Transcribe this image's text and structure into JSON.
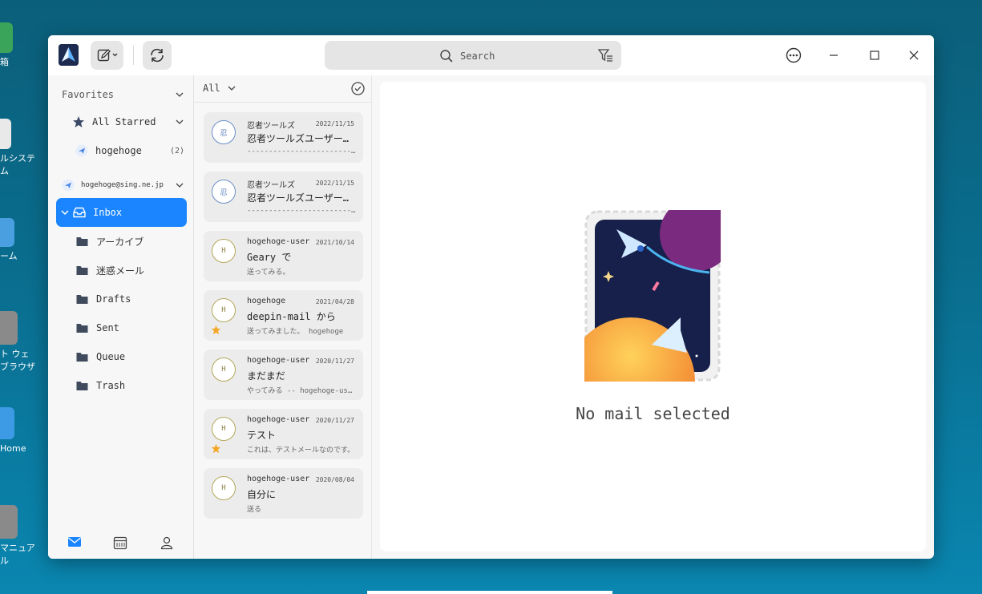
{
  "desktop": {
    "icons": [
      {
        "label": "箱",
        "color": "#3aa55a"
      },
      {
        "label": "ルシステ\nム",
        "color": "#e9e9e9"
      },
      {
        "label": "ーム",
        "color": "#4a9fe0"
      },
      {
        "label": "ト ウェ\nブラウザ",
        "color": "#3d8ee0"
      },
      {
        "label": " Home",
        "color": "#3d9be5"
      },
      {
        "label": "マニュア\nル",
        "color": "#2aa078"
      }
    ]
  },
  "window": {
    "search": {
      "placeholder": "Search"
    },
    "icons": {
      "compose": "compose-icon",
      "sync": "sync-icon",
      "filter": "filter-icon",
      "more": "more-icon",
      "minimize": "minimize-icon",
      "maximize": "maximize-icon",
      "close": "close-icon"
    }
  },
  "sidebar": {
    "favorites_label": "Favorites",
    "all_starred_label": "All Starred",
    "hogehoge_label": "hogehoge",
    "hogehoge_count": "(2)",
    "account_label": "hogehoge@sing.ne.jp",
    "folders": [
      {
        "label": "Inbox",
        "selected": true
      },
      {
        "label": "アーカイブ"
      },
      {
        "label": "迷惑メール"
      },
      {
        "label": "Drafts"
      },
      {
        "label": "Sent"
      },
      {
        "label": "Queue"
      },
      {
        "label": "Trash"
      }
    ],
    "bottom_icons": [
      "mail-icon",
      "calendar-icon",
      "contacts-icon"
    ]
  },
  "maillist": {
    "filter_label": "All",
    "items": [
      {
        "avatar": "忍",
        "sender": "忍者ツールズ",
        "date": "2022/11/15",
        "subject": "忍者ツールズユーザーの皆様へ",
        "preview": "------------------------------------",
        "starred": false,
        "avatar_type": "ninja"
      },
      {
        "avatar": "忍",
        "sender": "忍者ツールズ",
        "date": "2022/11/15",
        "subject": "忍者ツールズユーザーの皆様へ",
        "preview": "------------------------------------",
        "starred": false,
        "avatar_type": "ninja"
      },
      {
        "avatar": "H",
        "sender": "hogehoge-user",
        "date": "2021/10/14",
        "subject": "Geary で",
        "preview": "送ってみる。",
        "starred": false,
        "avatar_type": "user"
      },
      {
        "avatar": "H",
        "sender": "hogehoge",
        "date": "2021/04/28",
        "subject": "deepin-mail から",
        "preview": "送ってみました。 hogehoge",
        "starred": true,
        "avatar_type": "user"
      },
      {
        "avatar": "H",
        "sender": "hogehoge-user",
        "date": "2020/11/27",
        "subject": "まだまだ",
        "preview": "やってみる -- hogehoge-user",
        "starred": false,
        "avatar_type": "user"
      },
      {
        "avatar": "H",
        "sender": "hogehoge-user",
        "date": "2020/11/27",
        "subject": "テスト",
        "preview": "これは、テストメールなのです。",
        "starred": true,
        "avatar_type": "user"
      },
      {
        "avatar": "H",
        "sender": "hogehoge-user",
        "date": "2020/08/04",
        "subject": "自分に",
        "preview": "送る",
        "starred": false,
        "avatar_type": "user"
      }
    ]
  },
  "reading": {
    "empty_message": "No mail selected"
  },
  "colors": {
    "accent": "#1a85ff",
    "star": "#f5a623"
  }
}
